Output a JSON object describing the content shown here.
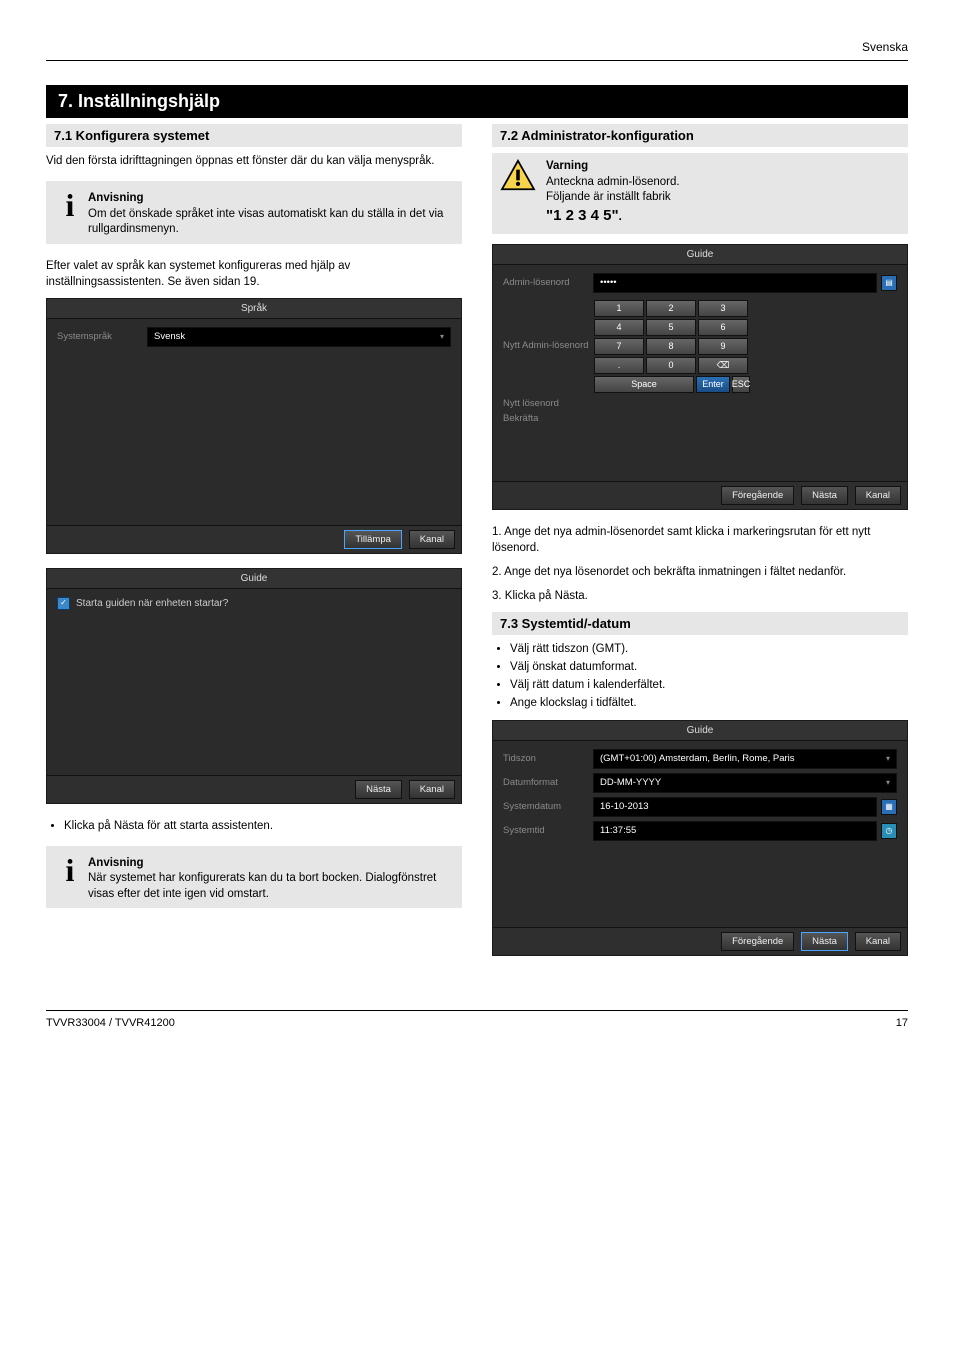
{
  "header_right": "Svenska",
  "section_bar": "7. Inställningshjälp",
  "left": {
    "h1": "7.1 Konfigurera systemet",
    "p1": "Vid den första idrifttagningen öppnas ett fönster där du kan välja menyspråk.",
    "note1_label": "Anvisning",
    "note1_text": "Om det önskade språket inte visas automatiskt kan du ställa in det via rullgardinsmenyn.",
    "p2": "Efter valet av språk kan systemet konfigureras med hjälp av inställningsassistenten. Se även sidan 19.",
    "shot1": {
      "title": "Språk",
      "label": "Systemspråk",
      "value": "Svensk",
      "btn_apply": "Tillämpa",
      "btn_cancel": "Kanal"
    },
    "shot2": {
      "title": "Guide",
      "check_label": "Starta guiden när enheten startar?",
      "btn_next": "Nästa",
      "btn_cancel": "Kanal"
    },
    "bullet1": "Klicka på Nästa för att starta assistenten.",
    "note2_label": "Anvisning",
    "note2_text": "När systemet har konfigurerats kan du ta bort bocken. Dialogfönstret visas efter det inte igen vid omstart."
  },
  "right": {
    "h2": "7.2 Administrator-konfiguration",
    "warn_label": "Varning",
    "warn_p1": "Anteckna admin-lösenord.",
    "warn_preset": "Följande är inställt fabrik",
    "warn_pwd": "\"1 2 3 4 5\"",
    "warn_bold_extra": ".",
    "p1": "1. Ange det nya admin-lösenordet samt klicka i markeringsrutan för ett nytt lösenord.",
    "p2": "2. Ange det nya lösenordet och bekräfta inmatningen i fältet nedanför.",
    "p3": "3. Klicka på Nästa.",
    "shot3": {
      "title": "Guide",
      "labels": [
        "Admin-lösenord",
        "Nytt Admin-lösenord",
        "Nytt lösenord",
        "Bekräfta"
      ],
      "value_mask": "•••••",
      "btn_prev": "Föregående",
      "btn_next": "Nästa",
      "btn_cancel": "Kanal",
      "keys": [
        [
          "1",
          "2",
          "3"
        ],
        [
          "4",
          "5",
          "6"
        ],
        [
          "7",
          "8",
          "9"
        ],
        [
          ".",
          "0",
          "⌫"
        ]
      ],
      "space": "Space",
      "enter": "Enter",
      "esc": "ESC"
    },
    "h3": "7.3 Systemtid/-datum",
    "b1": "Välj rätt tidszon (GMT).",
    "b2": "Välj önskat datumformat.",
    "b3": "Välj rätt datum i kalenderfältet.",
    "b4": "Ange klockslag i tidfältet.",
    "shot4": {
      "title": "Guide",
      "rows": [
        {
          "label": "Tidszon",
          "value": "(GMT+01:00) Amsterdam, Berlin, Rome, Paris",
          "caret": true
        },
        {
          "label": "Datumformat",
          "value": "DD-MM-YYYY",
          "caret": true
        },
        {
          "label": "Systemdatum",
          "value": "16-10-2013",
          "calendar": true
        },
        {
          "label": "Systemtid",
          "value": "11:37:55",
          "clock": true
        }
      ],
      "btn_prev": "Föregående",
      "btn_next": "Nästa",
      "btn_cancel": "Kanal"
    }
  },
  "footer_left": "TVVR33004 / TVVR41200",
  "footer_right": "17"
}
